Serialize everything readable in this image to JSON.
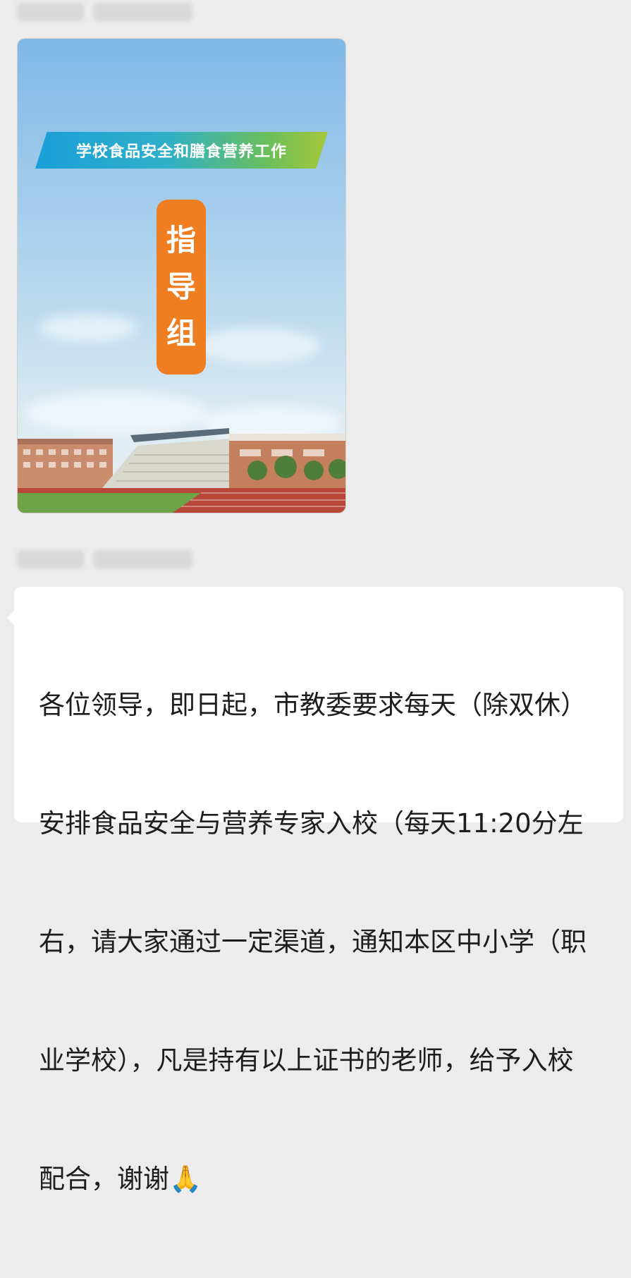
{
  "chat": {
    "messages": [
      {
        "type": "image",
        "poster": {
          "banner_title": "学校食品安全和膳食营养工作",
          "vertical_chars": [
            "指",
            "导",
            "组"
          ]
        }
      },
      {
        "type": "text",
        "lines": [
          "各位领导，即日起，市教委要求每天（除双休）",
          "安排食品安全与营养专家入校（每天11:20分左",
          "右，请大家通过一定渠道，通知本区中小学（职",
          "业学校），凡是持有以上证书的老师，给予入校",
          "配合，谢谢🙏"
        ]
      }
    ]
  },
  "colors": {
    "background": "#ececec",
    "bubble": "#ffffff",
    "badge_orange": "#ef7d22",
    "banner_start": "#1a9fd8",
    "banner_end": "#a6c83a"
  }
}
